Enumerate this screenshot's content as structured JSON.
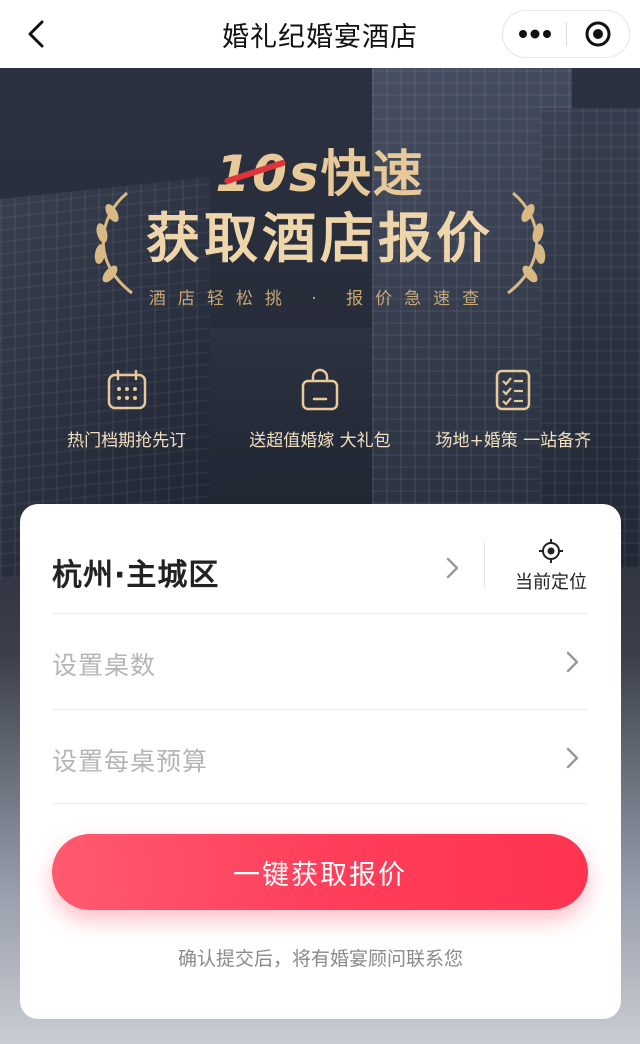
{
  "navbar": {
    "title": "婚礼纪婚宴酒店",
    "back_icon": "chevron-left-icon",
    "more_icon": "more-dots-icon",
    "close_icon": "target-close-icon"
  },
  "hero": {
    "headline_ten": "10s",
    "headline_line1_rest": "快速",
    "headline_line2": "获取酒店报价",
    "subtitle": "酒店轻松挑 · 报价急速查",
    "features": [
      {
        "icon": "calendar-icon",
        "label": "热门档期抢先订"
      },
      {
        "icon": "gift-bag-icon",
        "label": "送超值婚嫁 大礼包"
      },
      {
        "icon": "checklist-icon",
        "label": "场地+婚策 一站备齐"
      }
    ]
  },
  "form": {
    "city": "杭州·主城区",
    "locate_label": "当前定位",
    "tables_placeholder": "设置桌数",
    "budget_placeholder": "设置每桌预算",
    "submit_label": "一键获取报价",
    "notice": "确认提交后，将有婚宴顾问联系您"
  },
  "colors": {
    "accent": "#ff3f5b",
    "gold": "#e8c99a",
    "placeholder": "#b5b5b5"
  }
}
